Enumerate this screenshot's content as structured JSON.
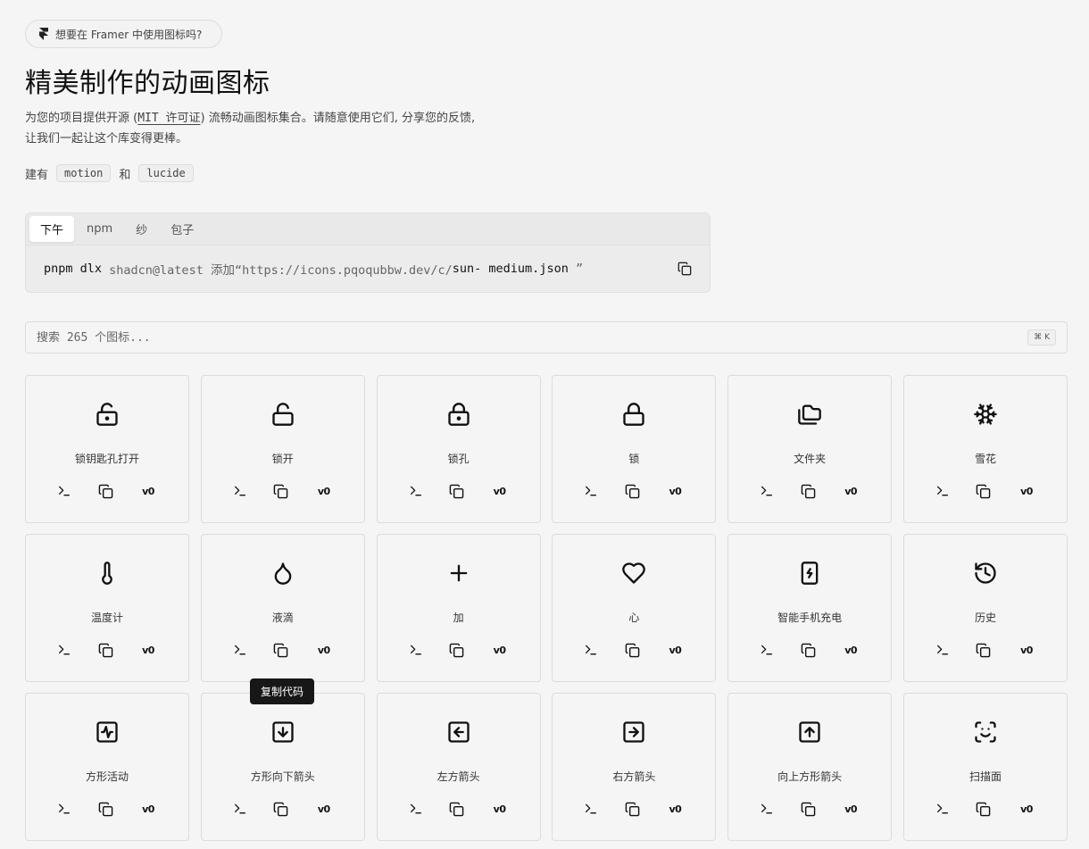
{
  "banner": {
    "text": "想要在 Framer 中使用图标吗?",
    "icon": "framer-icon"
  },
  "header": {
    "title": "精美制作的动画图标",
    "desc_before": "为您的项目提供开源 (",
    "desc_link": "MIT 许可证",
    "desc_after": ") 流畅动画图标集合。请随意使用它们, 分享您的反馈, 让我们一起让这个库变得更棒。",
    "built_with": "建有",
    "and": "和",
    "tag1": "motion",
    "tag2": "lucide"
  },
  "install": {
    "tabs": [
      {
        "label": "下午",
        "active": true
      },
      {
        "label": "npm",
        "active": false
      },
      {
        "label": "纱",
        "active": false
      },
      {
        "label": "包子",
        "active": false
      }
    ],
    "cmd_dark1": "pnpm dlx",
    "cmd_mid": " shadcn@latest 添加“https://icons.pqoqubbw.dev/c/",
    "cmd_dark2": "sun- medium.json",
    "cmd_end": " ”"
  },
  "search": {
    "placeholder": "搜索 265 个图标...",
    "shortcut": "⌘ K"
  },
  "icons": [
    {
      "name": "锁钥匙孔打开",
      "icon": "lock-keyhole-open-icon"
    },
    {
      "name": "锁开",
      "icon": "lock-open-icon"
    },
    {
      "name": "锁孔",
      "icon": "lock-keyhole-icon"
    },
    {
      "name": "锁",
      "icon": "lock-icon"
    },
    {
      "name": "文件夹",
      "icon": "folders-icon"
    },
    {
      "name": "雪花",
      "icon": "snowflake-icon"
    },
    {
      "name": "温度计",
      "icon": "thermometer-icon"
    },
    {
      "name": "液滴",
      "icon": "droplet-icon"
    },
    {
      "name": "加",
      "icon": "plus-icon"
    },
    {
      "name": "心",
      "icon": "heart-icon"
    },
    {
      "name": "智能手机充电",
      "icon": "smartphone-charging-icon"
    },
    {
      "name": "历史",
      "icon": "history-icon"
    },
    {
      "name": "方形活动",
      "icon": "square-activity-icon"
    },
    {
      "name": "方形向下箭头",
      "icon": "square-arrow-down-icon"
    },
    {
      "name": "左方箭头",
      "icon": "square-arrow-left-icon"
    },
    {
      "name": "右方箭头",
      "icon": "square-arrow-right-icon"
    },
    {
      "name": "向上方形箭头",
      "icon": "square-arrow-up-icon"
    },
    {
      "name": "扫描面",
      "icon": "scan-face-icon"
    }
  ],
  "card_actions": {
    "v0_label": "v0"
  },
  "tooltip": {
    "text": "复制代码"
  }
}
